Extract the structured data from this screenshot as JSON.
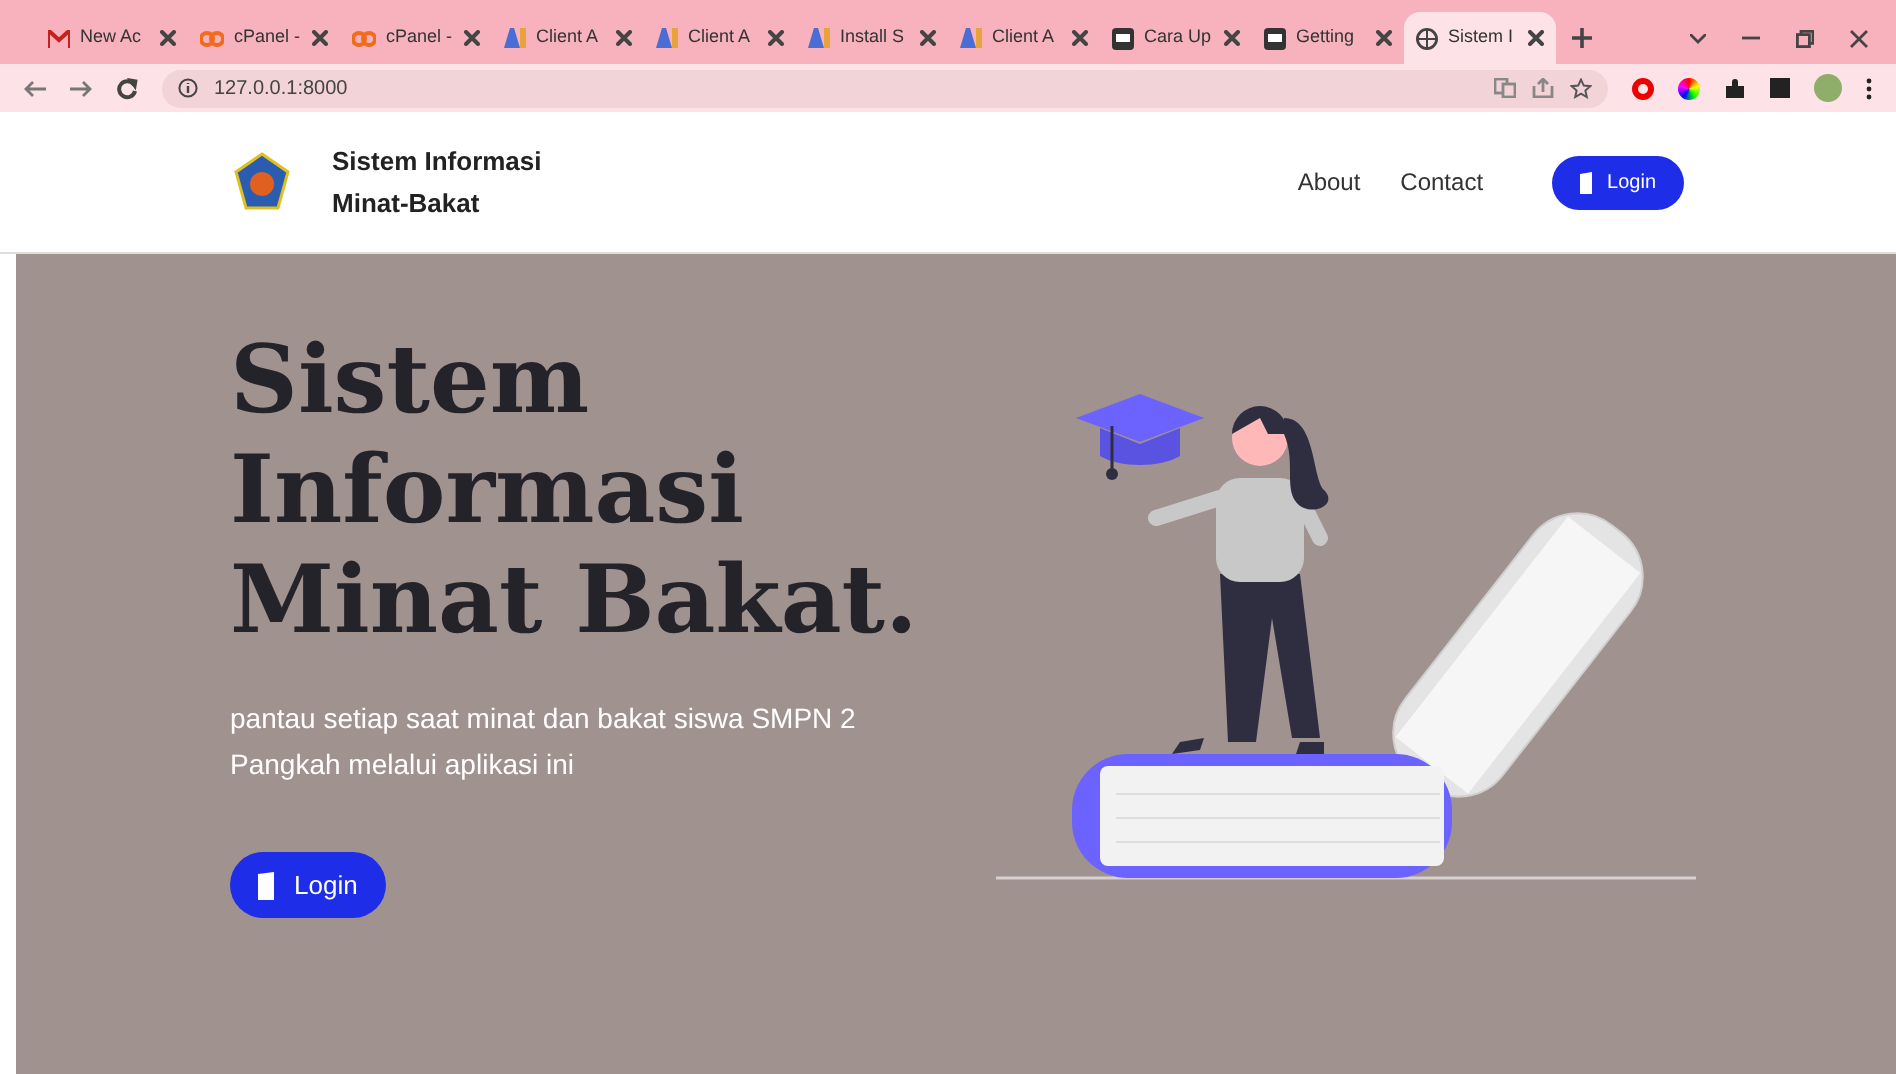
{
  "browser": {
    "tabs": [
      {
        "label": "New Ac",
        "kind": "mail",
        "selected": false
      },
      {
        "label": "cPanel -",
        "kind": "cpanel",
        "selected": false
      },
      {
        "label": "cPanel -",
        "kind": "cpanel",
        "selected": false
      },
      {
        "label": "Client A",
        "kind": "letter",
        "selected": false
      },
      {
        "label": "Client A",
        "kind": "letter",
        "selected": false
      },
      {
        "label": "Install S",
        "kind": "letter",
        "selected": false
      },
      {
        "label": "Client A",
        "kind": "letter",
        "selected": false
      },
      {
        "label": "Cara Up",
        "kind": "square",
        "selected": false
      },
      {
        "label": "Getting",
        "kind": "square",
        "selected": false
      },
      {
        "label": "Sistem I",
        "kind": "globe",
        "selected": true
      }
    ],
    "address": "127.0.0.1:8000"
  },
  "navbar": {
    "brand": "Sistem Informasi\nMinat-Bakat",
    "links": [
      "About",
      "Contact"
    ],
    "login": "Login"
  },
  "hero": {
    "title": "Sistem\nInformasi\nMinat Bakat.",
    "subtitle": "pantau setiap saat minat dan bakat siswa SMPN 2 Pangkah melalui aplikasi ini",
    "button": "Login"
  }
}
